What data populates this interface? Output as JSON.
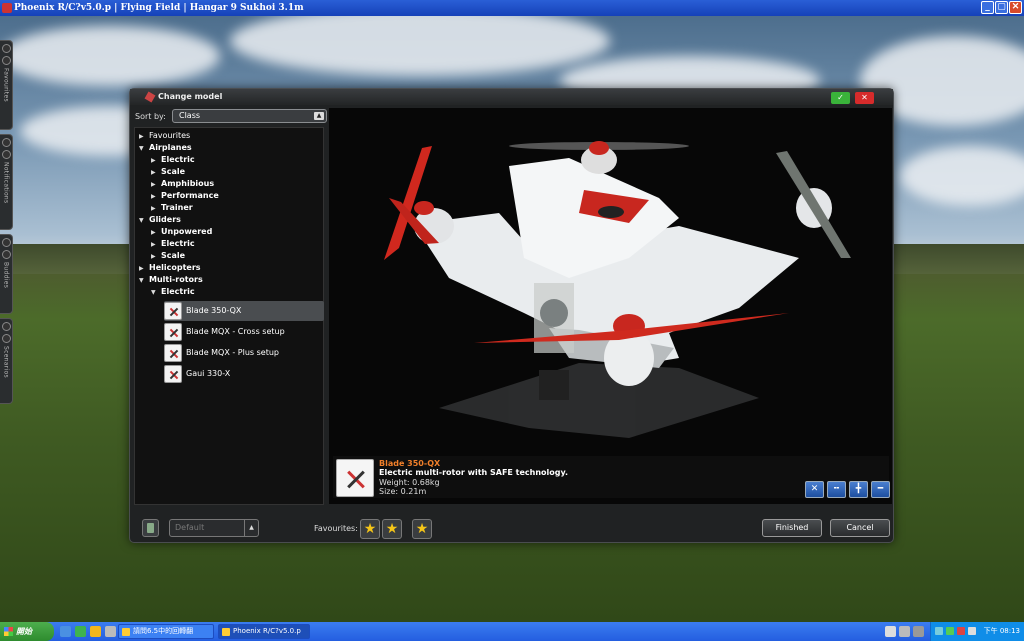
{
  "window": {
    "title": "Phoenix R/C?v5.0.p | Flying Field | Hangar 9 Sukhoi 3.1m",
    "min": "_",
    "max": "▢",
    "close": "✕"
  },
  "side_tabs": [
    "Favourites",
    "Notifications",
    "Buddies",
    "Scenarios"
  ],
  "dialog": {
    "title": "Change model",
    "ok_icon": "✓",
    "close_icon": "✕",
    "sort_label": "Sort by:",
    "sort_value": "Class"
  },
  "tree": {
    "favourites": "Favourites",
    "airplanes": "Airplanes",
    "airplanes_electric": "Electric",
    "airplanes_scale": "Scale",
    "amphibious": "Amphibious",
    "performance": "Performance",
    "trainer": "Trainer",
    "gliders": "Gliders",
    "unpowered": "Unpowered",
    "gliders_electric": "Electric",
    "gliders_scale": "Scale",
    "helicopters": "Helicopters",
    "multirotors": "Multi-rotors",
    "multirotors_electric": "Electric",
    "models": [
      "Blade 350-QX",
      "Blade MQX - Cross setup",
      "Blade MQX - Plus setup",
      "Gaui 330-X"
    ]
  },
  "info": {
    "name": "Blade 350-QX",
    "description": "Electric multi-rotor with SAFE technology.",
    "weight": "Weight: 0.68kg",
    "size": "Size: 0.21m"
  },
  "bottom": {
    "default_placeholder": "Default",
    "favourites_label": "Favourites:",
    "finished": "Finished",
    "cancel": "Cancel"
  },
  "taskbar": {
    "start": "開始",
    "task1": "請問6.5中的回轉翻",
    "task2": "Phoenix R/C?v5.0.p",
    "clock": "下午 08:13"
  }
}
